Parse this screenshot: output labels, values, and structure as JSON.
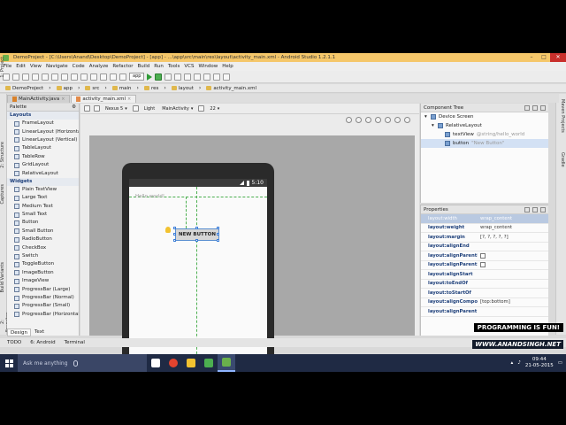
{
  "window": {
    "title": "DemoProject - [C:\\Users\\Anand\\Desktop\\DemoProject] - [app] - ...\\app\\src\\main\\res\\layout\\activity_main.xml - Android Studio 1.2.1.1",
    "minimize": "–",
    "maximize": "□",
    "close": "✕"
  },
  "menu": [
    "File",
    "Edit",
    "View",
    "Navigate",
    "Code",
    "Analyze",
    "Refactor",
    "Build",
    "Run",
    "Tools",
    "VCS",
    "Window",
    "Help"
  ],
  "toolbar": {
    "config": "app"
  },
  "breadcrumb": [
    "DemoProject",
    "app",
    "src",
    "main",
    "res",
    "layout",
    "activity_main.xml"
  ],
  "editor_tabs": [
    {
      "label": "MainActivity.java",
      "active": false
    },
    {
      "label": "activity_main.xml",
      "active": true
    }
  ],
  "left_strip": [
    "1: Project",
    "2: Structure",
    "Captures",
    "Build Variants",
    "2: Favorites"
  ],
  "right_strip": [
    "Maven Projects",
    "Gradle"
  ],
  "palette": {
    "title": "Palette",
    "groups": [
      {
        "name": "Layouts",
        "items": [
          "FrameLayout",
          "LinearLayout (Horizontal)",
          "LinearLayout (Vertical)",
          "TableLayout",
          "TableRow",
          "GridLayout",
          "RelativeLayout"
        ]
      },
      {
        "name": "Widgets",
        "items": [
          "Plain TextView",
          "Large Text",
          "Medium Text",
          "Small Text",
          "Button",
          "Small Button",
          "RadioButton",
          "CheckBox",
          "Switch",
          "ToggleButton",
          "ImageButton",
          "ImageView",
          "ProgressBar (Large)",
          "ProgressBar (Normal)",
          "ProgressBar (Small)",
          "ProgressBar (Horizontal)"
        ]
      }
    ]
  },
  "design_toolbar": {
    "device": "Nexus 5",
    "theme": "Light",
    "activity": "MainActivity",
    "api": "22"
  },
  "phone": {
    "time": "5:10",
    "hello_text": "Hello world!",
    "button_text": "NEW BUTTON"
  },
  "component_tree": {
    "title": "Component Tree",
    "rows": [
      {
        "name": "Device Screen",
        "hint": "",
        "indent": 0,
        "selected": false
      },
      {
        "name": "RelativeLayout",
        "hint": "",
        "indent": 1,
        "selected": false
      },
      {
        "name": "textView",
        "hint": "@string/hello_world",
        "indent": 2,
        "selected": false
      },
      {
        "name": "button",
        "hint": "\"New Button\"",
        "indent": 2,
        "selected": true
      }
    ]
  },
  "properties": {
    "title": "Properties",
    "rows": [
      {
        "key": "layout:width",
        "value": "wrap_content",
        "header": true,
        "checkbox": false
      },
      {
        "key": "layout:weight",
        "value": "wrap_content",
        "header": false,
        "checkbox": false
      },
      {
        "key": "layout:margin",
        "value": "[?, ?, ?, ?, ?]",
        "header": false,
        "checkbox": false
      },
      {
        "key": "layout:alignEnd",
        "value": "",
        "header": false,
        "checkbox": false
      },
      {
        "key": "layout:alignParentEnd",
        "value": "",
        "header": false,
        "checkbox": true
      },
      {
        "key": "layout:alignParentStart",
        "value": "",
        "header": false,
        "checkbox": true
      },
      {
        "key": "layout:alignStart",
        "value": "",
        "header": false,
        "checkbox": false
      },
      {
        "key": "layout:toEndOf",
        "value": "",
        "header": false,
        "checkbox": false
      },
      {
        "key": "layout:toStartOf",
        "value": "",
        "header": false,
        "checkbox": false
      },
      {
        "key": "layout:alignComponent",
        "value": "[top:bottom]",
        "header": false,
        "checkbox": false
      },
      {
        "key": "layout:alignParent",
        "value": "",
        "header": false,
        "checkbox": false
      }
    ]
  },
  "bottom": {
    "tabs": [
      "Design",
      "Text"
    ],
    "tools": [
      "TODO",
      "6: Android",
      "Terminal"
    ]
  },
  "branding": {
    "line1": "PROGRAMMING IS FUN!",
    "line2": "WWW.ANANDSINGH.NET"
  },
  "taskbar": {
    "search_placeholder": "Ask me anything",
    "time": "09:44",
    "date": "21-05-2015",
    "apps": [
      {
        "name": "task-view",
        "color": "#ffffff"
      },
      {
        "name": "chrome",
        "color": "#e4442f"
      },
      {
        "name": "file-explorer",
        "color": "#f2c230"
      },
      {
        "name": "store",
        "color": "#4caf50"
      },
      {
        "name": "android-studio",
        "color": "#6ab04c"
      }
    ]
  }
}
